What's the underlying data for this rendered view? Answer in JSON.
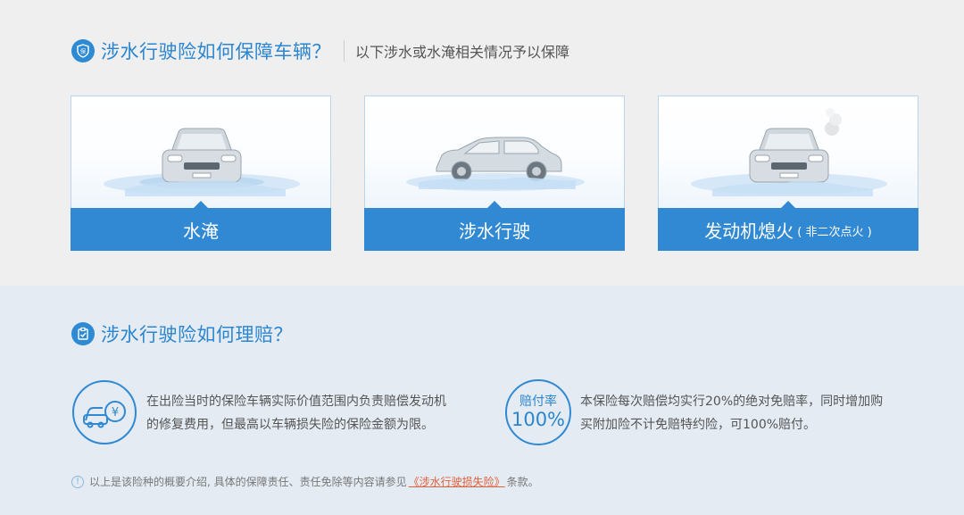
{
  "coverage": {
    "title": "涉水行驶险如何保障车辆？",
    "subtitle": "以下涉水或水淹相关情况予以保障",
    "icon": "shield-icon",
    "cards": [
      {
        "label": "水淹",
        "note": "",
        "icon": "flooded-car-icon"
      },
      {
        "label": "涉水行驶",
        "note": "",
        "icon": "wading-car-icon"
      },
      {
        "label": "发动机熄火",
        "note": "( 非二次点火 )",
        "icon": "stalled-car-icon"
      }
    ]
  },
  "claims": {
    "title": "涉水行驶险如何理赔？",
    "icon": "clipboard-icon",
    "items": [
      {
        "icon": "car-money-icon",
        "text_line1": "在出险当时的保险车辆实际价值范围内负责赔偿发动机",
        "text_line2": "的修复费用，但最高以车辆损失险的保险金额为限。"
      },
      {
        "rate_label": "赔付率",
        "rate_value": "100%",
        "text_line1": "本保险每次赔偿均实行20%的绝对免赔率，同时增加购",
        "text_line2": "买附加险不计免赔特约险，可100%赔付。"
      }
    ]
  },
  "footnote": {
    "before": "以上是该险种的概要介绍, 具体的保障责任、责任免除等内容请参见",
    "link": "《涉水行驶损失险》",
    "after": "条款。"
  },
  "colors": {
    "accent": "#3089d2",
    "title_blue": "#2b86cf",
    "link_orange": "#e0603c",
    "top_bg": "#efeff0",
    "bottom_bg": "#e4ebf3"
  }
}
